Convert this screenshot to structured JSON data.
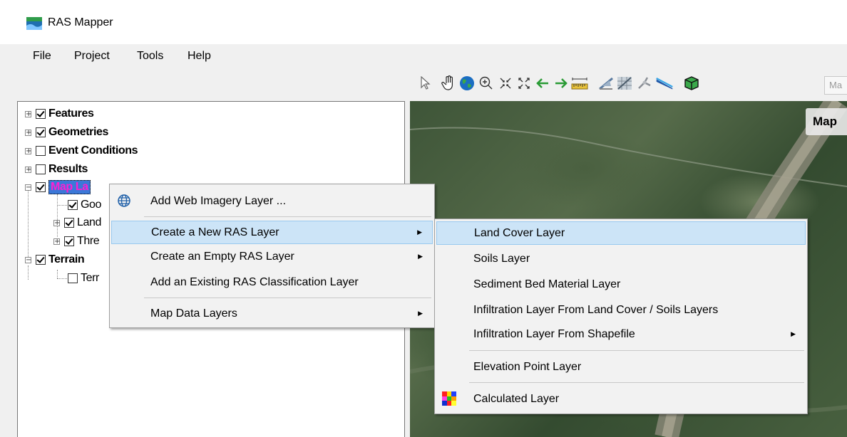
{
  "window": {
    "title": "RAS Mapper"
  },
  "menubar": [
    "File",
    "Project",
    "Tools",
    "Help"
  ],
  "toolbar": {
    "icons": [
      "select-arrow-icon",
      "pan-hand-icon",
      "globe-icon",
      "zoom-in-icon",
      "zoom-full-icon",
      "zoom-extent-icon",
      "back-arrow-icon",
      "forward-arrow-icon",
      "measure-ruler-icon",
      "profile-line-icon",
      "raster-grid-icon",
      "flow-icon",
      "river-line-icon",
      "cube-3d-icon"
    ],
    "textbox": "Ma"
  },
  "tree": {
    "nodes": [
      {
        "label": "Features",
        "checked": true
      },
      {
        "label": "Geometries",
        "checked": true
      },
      {
        "label": "Event Conditions",
        "checked": false
      },
      {
        "label": "Results",
        "checked": false
      },
      {
        "label": "Map La",
        "checked": true
      },
      {
        "label": "Goo",
        "checked": true
      },
      {
        "label": "Land",
        "checked": true
      },
      {
        "label": "Thre",
        "checked": true
      },
      {
        "label": "Terrain",
        "checked": true
      },
      {
        "label": "Terr",
        "checked": false
      }
    ]
  },
  "map": {
    "label": "Map"
  },
  "context_menu": {
    "items": [
      {
        "label": "Add Web Imagery Layer ...",
        "icon": "globe-icon"
      },
      {
        "label": "Create a New RAS Layer",
        "submenu": true,
        "highlighted": true
      },
      {
        "label": "Create an Empty RAS Layer",
        "submenu": true
      },
      {
        "label": "Add an Existing RAS Classification Layer"
      },
      {
        "label": "Map Data Layers",
        "submenu": true
      }
    ]
  },
  "submenu": {
    "items": [
      {
        "label": "Land Cover Layer",
        "highlighted": true
      },
      {
        "label": "Soils Layer"
      },
      {
        "label": "Sediment Bed Material Layer"
      },
      {
        "label": "Infiltration Layer From Land Cover / Soils Layers"
      },
      {
        "label": "Infiltration Layer From Shapefile",
        "submenu": true
      },
      {
        "label": "Elevation Point Layer"
      },
      {
        "label": "Calculated Layer",
        "icon": "calculated-layer-icon"
      }
    ]
  }
}
